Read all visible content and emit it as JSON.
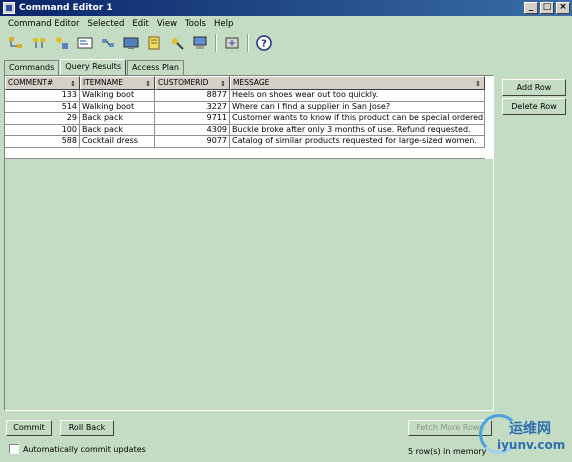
{
  "window": {
    "title": "Command Editor 1"
  },
  "menu": [
    "Command Editor",
    "Selected",
    "Edit",
    "View",
    "Tools",
    "Help"
  ],
  "tabs": [
    {
      "label": "Commands"
    },
    {
      "label": "Query Results"
    },
    {
      "label": "Access Plan"
    }
  ],
  "grid": {
    "columns": [
      "COMMENT#",
      "ITEMNAME",
      "CUSTOMERID",
      "MESSAGE"
    ],
    "rows": [
      [
        "133",
        "Walking boot",
        "8877",
        "Heels on shoes wear out too quickly."
      ],
      [
        "514",
        "Walking boot",
        "3227",
        "Where can I find a supplier in San Jose?"
      ],
      [
        "29",
        "Back pack",
        "9711",
        "Customer wants to know if this product can be special ordered in bri..."
      ],
      [
        "100",
        "Back pack",
        "4309",
        "Buckle broke after only 3 months of use.  Refund requested."
      ],
      [
        "588",
        "Cocktail dress",
        "9077",
        "Catalog of similar products requested for large-sized women."
      ]
    ]
  },
  "side_buttons": {
    "add_row": "Add Row",
    "delete_row": "Delete Row"
  },
  "bottom": {
    "commit": "Commit",
    "roll_back": "Roll Back",
    "fetch_more": "Fetch More Rows",
    "auto_commit": "Automatically commit updates",
    "status": "5 row(s) in memory"
  },
  "watermark": {
    "cn": "运维网",
    "url": "iyunv.com"
  }
}
